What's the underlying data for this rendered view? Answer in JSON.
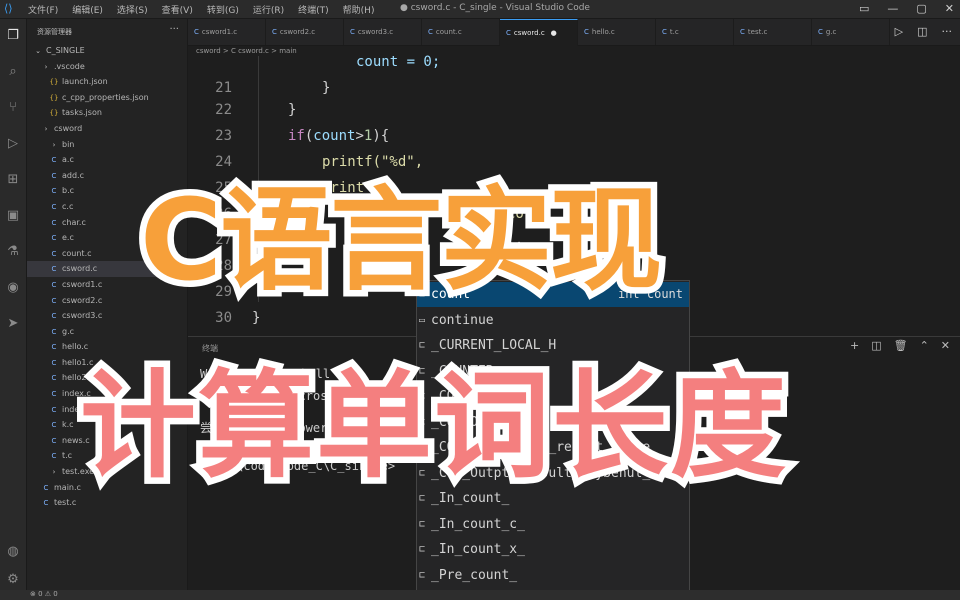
{
  "titlebar": {
    "menu": [
      "文件(F)",
      "编辑(E)",
      "选择(S)",
      "查看(V)",
      "转到(G)",
      "运行(R)",
      "终端(T)",
      "帮助(H)"
    ],
    "window_title": "● csword.c - C_single - Visual Studio Code"
  },
  "activity_icons": [
    "files-icon",
    "search-icon",
    "source-control-icon",
    "run-debug-icon",
    "extensions-icon",
    "remote-explorer-icon",
    "testing-icon",
    "github-icon",
    "share-icon",
    "account-icon",
    "settings-icon"
  ],
  "sidebar": {
    "header": "资源管理器",
    "root": "C_SINGLE",
    "items": [
      {
        "label": ".vscode",
        "icon": "d",
        "indent": 1
      },
      {
        "label": "launch.json",
        "icon": "j",
        "indent": 2
      },
      {
        "label": "c_cpp_properties.json",
        "icon": "j",
        "indent": 2
      },
      {
        "label": "tasks.json",
        "icon": "j",
        "indent": 2
      },
      {
        "label": "csword",
        "icon": "d",
        "indent": 1
      },
      {
        "label": "bin",
        "icon": "d",
        "indent": 2
      },
      {
        "label": "a.c",
        "icon": "c",
        "indent": 2
      },
      {
        "label": "add.c",
        "icon": "c",
        "indent": 2
      },
      {
        "label": "b.c",
        "icon": "c",
        "indent": 2
      },
      {
        "label": "c.c",
        "icon": "c",
        "indent": 2
      },
      {
        "label": "char.c",
        "icon": "c",
        "indent": 2
      },
      {
        "label": "e.c",
        "icon": "c",
        "indent": 2
      },
      {
        "label": "count.c",
        "icon": "c",
        "indent": 2
      },
      {
        "label": "csword.c",
        "icon": "c",
        "indent": 2,
        "selected": true
      },
      {
        "label": "csword1.c",
        "icon": "c",
        "indent": 2
      },
      {
        "label": "csword2.c",
        "icon": "c",
        "indent": 2
      },
      {
        "label": "csword3.c",
        "icon": "c",
        "indent": 2
      },
      {
        "label": "g.c",
        "icon": "c",
        "indent": 2
      },
      {
        "label": "hello.c",
        "icon": "c",
        "indent": 2
      },
      {
        "label": "hello1.c",
        "icon": "c",
        "indent": 2
      },
      {
        "label": "hello2.c",
        "icon": "c",
        "indent": 2
      },
      {
        "label": "index.c",
        "icon": "c",
        "indent": 2
      },
      {
        "label": "index1.c",
        "icon": "c",
        "indent": 2
      },
      {
        "label": "k.c",
        "icon": "c",
        "indent": 2
      },
      {
        "label": "news.c",
        "icon": "c",
        "indent": 2
      },
      {
        "label": "t.c",
        "icon": "c",
        "indent": 2
      },
      {
        "label": "test.exe",
        "icon": "d",
        "indent": 2
      },
      {
        "label": "main.c",
        "icon": "c",
        "indent": 1
      },
      {
        "label": "test.c",
        "icon": "c",
        "indent": 1
      }
    ]
  },
  "tabs": [
    {
      "label": "csword1.c",
      "active": false
    },
    {
      "label": "csword2.c",
      "active": false
    },
    {
      "label": "csword3.c",
      "active": false
    },
    {
      "label": "count.c",
      "active": false
    },
    {
      "label": "csword.c",
      "active": true,
      "dirty": true
    },
    {
      "label": "hello.c",
      "active": false
    },
    {
      "label": "t.c",
      "active": false
    },
    {
      "label": "test.c",
      "active": false
    },
    {
      "label": "g.c",
      "active": false
    }
  ],
  "breadcrumb": "csword > C csword.c > main",
  "editor": {
    "line_numbers": [
      "21",
      "22",
      "23",
      "24",
      "25",
      "26",
      "27",
      "28",
      "29",
      "30"
    ],
    "lines": {
      "l20": "count = 0;",
      "l21": "}",
      "l22": "}",
      "l23_kw": "if",
      "l23_a": "(",
      "l23_var": "count",
      "l23_b": ">",
      "l23_num": "1",
      "l23_c": "){",
      "l24": "printf(\"%d\",",
      "l25": "print",
      "l26": "printf(co",
      "l26_r": "cons",
      "l27": "I",
      "l27_r": "...",
      "l28": "d\",co",
      "l30": "}"
    }
  },
  "suggest": {
    "items": [
      {
        "label": "count",
        "detail": "int count",
        "selected": true
      },
      {
        "label": "continue",
        "detail": ""
      },
      {
        "label": "_CURRENT_LOCAL_H",
        "detail": ""
      },
      {
        "label": "_COUNTER",
        "detail": ""
      },
      {
        "label": "_COM_Outptr",
        "detail": ""
      },
      {
        "label": "_COM_Outptr_opt",
        "detail": ""
      },
      {
        "label": "_COM_Outptr_opt_result_maybe",
        "detail": ""
      },
      {
        "label": "_COM_Outptr_result_maybenul_",
        "detail": ""
      },
      {
        "label": "_In_count_",
        "detail": ""
      },
      {
        "label": "_In_count_c_",
        "detail": ""
      },
      {
        "label": "_In_count_x_",
        "detail": ""
      },
      {
        "label": "_Pre_count_",
        "detail": ""
      }
    ]
  },
  "panel": {
    "tab": "终端",
    "terminal": [
      "Windows PowerShell",
      "版权所有 (C) Microsoft Corporation",
      "尝试新的跨平台 PowerShell",
      "PS E:\\code\\Code_C\\C_single>"
    ]
  },
  "statusbar": "⊗ 0 ⚠ 0",
  "overlay": {
    "line1": "C语言实现",
    "line2": "计算单词长度"
  }
}
